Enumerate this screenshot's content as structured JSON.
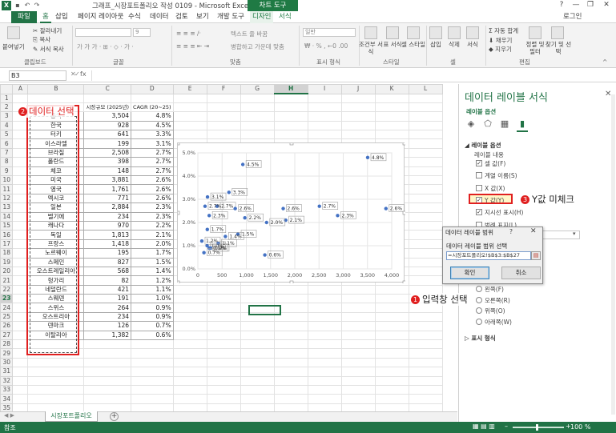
{
  "titlebar": {
    "title": "그래프_시장포트폴리오 작성 0109 - Microsoft Excel",
    "context_group": "차트 도구",
    "min": "—",
    "restore": "❐",
    "close": "✕",
    "help": "?"
  },
  "tabs": {
    "file": "파일",
    "home": "홈",
    "insert": "삽입",
    "page_layout": "페이지 레이아웃",
    "formulas": "수식",
    "data": "데이터",
    "review": "검토",
    "view": "보기",
    "developer": "개발 도구",
    "design": "디자인",
    "format": "서식",
    "login": "로그인"
  },
  "ribbon": {
    "paste": "붙여넣기",
    "cut": "잘라내기",
    "copy": "복사",
    "format_painter": "서식 복사",
    "font_size": "9",
    "wrap_text": "텍스트 줄 바꿈",
    "merge_center": "병합하고 가운데 맞춤",
    "number_format": "일반",
    "conditional": "조건부\n서식",
    "format_table": "표\n서식",
    "cell_style": "셀\n스타일",
    "insert": "삽입",
    "delete": "삭제",
    "format": "서식",
    "autosum": "자동 합계",
    "fill": "채우기",
    "clear": "지우기",
    "sort_filter": "정렬 및\n필터",
    "find_select": "찾기 및\n선택",
    "groups": {
      "clipboard": "클립보드",
      "font": "글꼴",
      "alignment": "맞춤",
      "number": "표시 형식",
      "styles": "스타일",
      "cells": "셀",
      "editing": "편집"
    }
  },
  "formula_bar": {
    "name_box": "B3",
    "fx": "fx",
    "cancel": "✕",
    "enter": "✓"
  },
  "columns": [
    "A",
    "B",
    "C",
    "D",
    "E",
    "F",
    "G",
    "H",
    "I",
    "J",
    "K",
    "L"
  ],
  "table": {
    "header_c": "시장규모\n(2025년)",
    "header_d": "CAGR\n(20~25)",
    "rows": [
      {
        "r": 3,
        "name": "중국",
        "size": "3,504",
        "cagr": "4.8%"
      },
      {
        "r": 4,
        "name": "한국",
        "size": "928",
        "cagr": "4.5%"
      },
      {
        "r": 5,
        "name": "터키",
        "size": "641",
        "cagr": "3.3%"
      },
      {
        "r": 6,
        "name": "이스라엘",
        "size": "199",
        "cagr": "3.1%"
      },
      {
        "r": 7,
        "name": "브라질",
        "size": "2,508",
        "cagr": "2.7%"
      },
      {
        "r": 8,
        "name": "폴란드",
        "size": "398",
        "cagr": "2.7%"
      },
      {
        "r": 9,
        "name": "체코",
        "size": "148",
        "cagr": "2.7%"
      },
      {
        "r": 10,
        "name": "미국",
        "size": "3,881",
        "cagr": "2.6%"
      },
      {
        "r": 11,
        "name": "영국",
        "size": "1,761",
        "cagr": "2.6%"
      },
      {
        "r": 12,
        "name": "멕시코",
        "size": "771",
        "cagr": "2.6%"
      },
      {
        "r": 13,
        "name": "일본",
        "size": "2,884",
        "cagr": "2.3%"
      },
      {
        "r": 14,
        "name": "벨기에",
        "size": "234",
        "cagr": "2.3%"
      },
      {
        "r": 15,
        "name": "캐나다",
        "size": "970",
        "cagr": "2.2%"
      },
      {
        "r": 16,
        "name": "독일",
        "size": "1,813",
        "cagr": "2.1%"
      },
      {
        "r": 17,
        "name": "프랑스",
        "size": "1,418",
        "cagr": "2.0%"
      },
      {
        "r": 18,
        "name": "노르웨이",
        "size": "195",
        "cagr": "1.7%"
      },
      {
        "r": 19,
        "name": "스페인",
        "size": "827",
        "cagr": "1.5%"
      },
      {
        "r": 20,
        "name": "오스트레일리아",
        "size": "568",
        "cagr": "1.4%"
      },
      {
        "r": 21,
        "name": "헝가리",
        "size": "82",
        "cagr": "1.2%"
      },
      {
        "r": 22,
        "name": "네덜란드",
        "size": "421",
        "cagr": "1.1%"
      },
      {
        "r": 23,
        "name": "스웨덴",
        "size": "191",
        "cagr": "1.0%"
      },
      {
        "r": 24,
        "name": "스위스",
        "size": "264",
        "cagr": "0.9%"
      },
      {
        "r": 25,
        "name": "오스트리아",
        "size": "234",
        "cagr": "0.9%"
      },
      {
        "r": 26,
        "name": "덴마크",
        "size": "126",
        "cagr": "0.7%"
      },
      {
        "r": 27,
        "name": "이탈리아",
        "size": "1,382",
        "cagr": "0.6%"
      }
    ]
  },
  "chart_data": {
    "type": "scatter",
    "x": [
      3504,
      928,
      641,
      199,
      2508,
      398,
      148,
      3881,
      1761,
      771,
      2884,
      234,
      970,
      1813,
      1418,
      195,
      827,
      568,
      82,
      421,
      191,
      264,
      234,
      126,
      1382
    ],
    "y": [
      4.8,
      4.5,
      3.3,
      3.1,
      2.7,
      2.7,
      2.7,
      2.6,
      2.6,
      2.6,
      2.3,
      2.3,
      2.2,
      2.1,
      2.0,
      1.7,
      1.5,
      1.4,
      1.2,
      1.1,
      1.0,
      0.9,
      0.9,
      0.7,
      0.6
    ],
    "data_labels": [
      "4.8%",
      "4.5%",
      "3.3%",
      "3.1%",
      "2.7%",
      "2.7%",
      "2.7%",
      "2.6%",
      "2.6%",
      "2.6%",
      "2.3%",
      "2.3%",
      "2.2%",
      "2.1%",
      "2.0%",
      "1.7%",
      "1.5%",
      "1.4%",
      "1.2%",
      "1.1%",
      "1.0%",
      "0.9%",
      "0.9%",
      "0.7%",
      "0.6%"
    ],
    "xlim": [
      0,
      4000
    ],
    "ylim": [
      0,
      5
    ],
    "x_ticks": [
      "0",
      "500",
      "1,000",
      "1,500",
      "2,000",
      "2,500",
      "3,000",
      "3,500",
      "4,000"
    ],
    "y_ticks": [
      "0.0%",
      "1.0%",
      "2.0%",
      "3.0%",
      "4.0%",
      "5.0%"
    ],
    "grid": true,
    "marker_color": "#4472c4"
  },
  "sheet": {
    "tab": "시장포트폴리오",
    "add": "+"
  },
  "status": {
    "mode": "참조",
    "zoom": "100 %"
  },
  "pane": {
    "title": "데이터 레이블 서식",
    "close": "✕",
    "tab_label": "레이블 옵션",
    "section": "레이블 옵션",
    "content_label": "레이블 내용",
    "options": [
      {
        "label": "셀 값(F)",
        "checked": true
      },
      {
        "label": "계열 이름(S)",
        "checked": false
      },
      {
        "label": "X 값(X)",
        "checked": false
      },
      {
        "label": "Y 값(Y)",
        "checked": true
      },
      {
        "label": "지시선 표시(H)",
        "checked": true
      },
      {
        "label": "범례 표지(L)",
        "checked": false
      }
    ],
    "position": [
      {
        "label": "왼쪽(F)"
      },
      {
        "label": "오른쪽(R)"
      },
      {
        "label": "위쪽(O)"
      },
      {
        "label": "아래쪽(W)"
      }
    ],
    "number_section": "표시 형식"
  },
  "dialog": {
    "title": "데이터 레이블 범위",
    "help": "?",
    "close": "✕",
    "label": "데이터 레이블 범위 선택",
    "value": "=시장포트폴리오!$B$3:$B$27",
    "ok": "확인",
    "cancel": "취소"
  },
  "annotations": {
    "a1": "입력창 선택",
    "a2": "데이터 선택",
    "a3": "Y값 미체크",
    "n1": "1",
    "n2": "2",
    "n3": "3"
  },
  "colors": {
    "excel_green": "#217346",
    "annotation_red": "#e02020"
  }
}
